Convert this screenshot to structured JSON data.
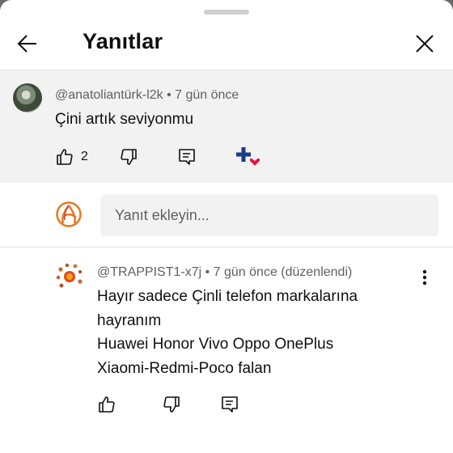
{
  "header": {
    "title": "Yanıtlar"
  },
  "parent_comment": {
    "author": "@anatoliantürk-l2k",
    "time": "7 gün önce",
    "meta_separator": " • ",
    "text": "Çini artık seviyonmu",
    "like_count": "2"
  },
  "reply_box": {
    "placeholder": "Yanıt ekleyin..."
  },
  "reply_comment": {
    "author": "@TRAPPIST1-x7j",
    "time": "7 gün önce (düzenlendi)",
    "meta_separator": " • ",
    "lines": [
      "Hayır sadece Çinli telefon markalarına",
      "hayranım",
      "Huawei Honor Vivo Oppo OnePlus",
      "Xiaomi-Redmi-Poco falan"
    ]
  },
  "colors": {
    "background": "#ffffff",
    "highlight": "#f2f2f2",
    "secondary_text": "#606060",
    "heart": "#e8173f",
    "creator_cross": "#1e3a8a"
  },
  "icons": [
    "back-arrow-icon",
    "close-icon",
    "thumbs-up-icon",
    "thumbs-down-icon",
    "reply-icon",
    "creator-heart-icon",
    "more-vert-icon"
  ]
}
